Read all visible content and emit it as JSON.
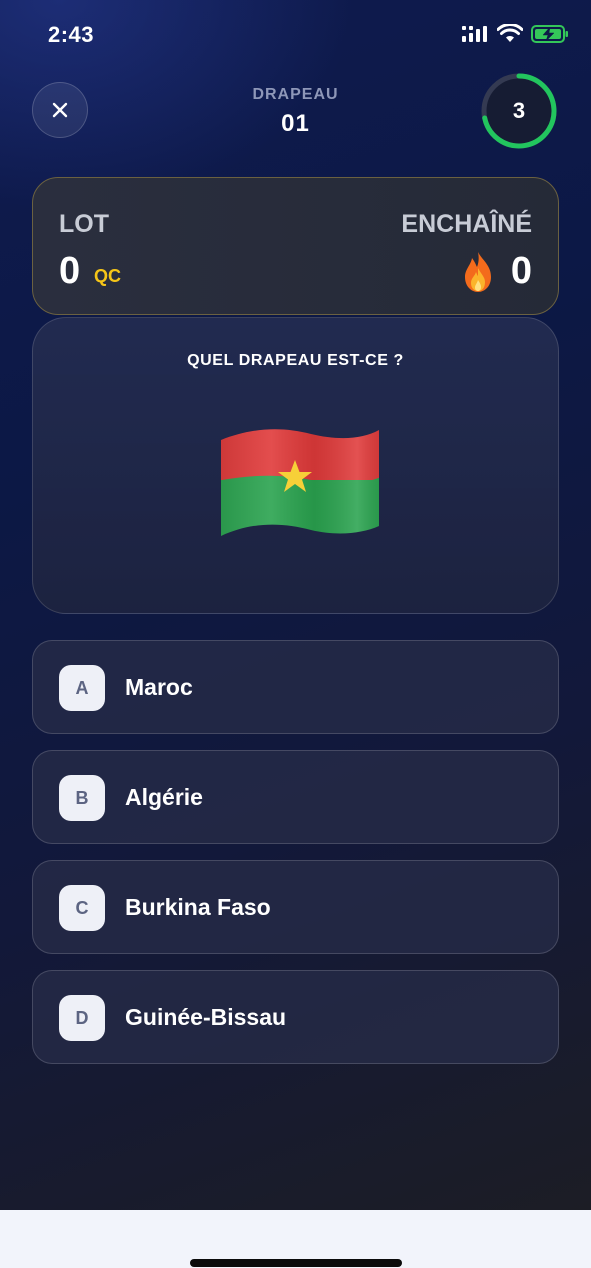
{
  "status_bar": {
    "time": "2:43",
    "signal_icon": "cellular-signal-icon",
    "wifi_icon": "wifi-icon",
    "battery_icon": "battery-charging-icon",
    "battery_color": "#34c759"
  },
  "header": {
    "close_icon": "close-icon",
    "category": "DRAPEAU",
    "question_number": "01",
    "timer_value": "3",
    "timer_ring_color": "#22c55e"
  },
  "score": {
    "lot_label": "LOT",
    "lot_value": "0",
    "lot_unit": "QC",
    "streak_label": "ENCHAÎNÉ",
    "streak_value": "0",
    "streak_icon": "fire-icon"
  },
  "question": {
    "prompt": "QUEL DRAPEAU EST-CE ?",
    "flag_icon": "burkina-faso-flag-icon"
  },
  "options": [
    {
      "letter": "A",
      "text": "Maroc"
    },
    {
      "letter": "B",
      "text": "Algérie"
    },
    {
      "letter": "C",
      "text": "Burkina Faso"
    },
    {
      "letter": "D",
      "text": "Guinée-Bissau"
    }
  ],
  "colors": {
    "accent_gold": "#f5c518",
    "card_border_gold": "#6b6140"
  }
}
